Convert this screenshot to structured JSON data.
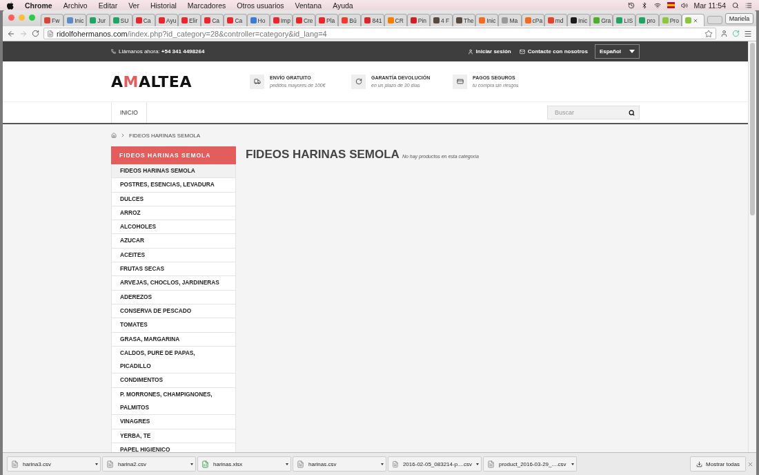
{
  "menubar": {
    "app": "Chrome",
    "items": [
      "Archivo",
      "Editar",
      "Ver",
      "Historial",
      "Marcadores",
      "Otros usuarios",
      "Ventana",
      "Ayuda"
    ],
    "clock": "Mar 11:54"
  },
  "tabs": [
    {
      "title": "Fw",
      "color": "#d44638",
      "selected": false
    },
    {
      "title": "Inic",
      "color": "#5b8bc9",
      "selected": false
    },
    {
      "title": "Jur",
      "color": "#1fa463",
      "selected": false
    },
    {
      "title": "SU",
      "color": "#1fa463",
      "selected": false
    },
    {
      "title": "Ca",
      "color": "#e8262b",
      "selected": false
    },
    {
      "title": "Ayu",
      "color": "#e8262b",
      "selected": false
    },
    {
      "title": "Elir",
      "color": "#e8262b",
      "selected": false
    },
    {
      "title": "Ca",
      "color": "#e8262b",
      "selected": false
    },
    {
      "title": "Ca",
      "color": "#e8262b",
      "selected": false
    },
    {
      "title": "Ho",
      "color": "#3a7bd5",
      "selected": false
    },
    {
      "title": "Imp",
      "color": "#e8262b",
      "selected": false
    },
    {
      "title": "Cre",
      "color": "#e8262b",
      "selected": false
    },
    {
      "title": "Pla",
      "color": "#e8262b",
      "selected": false
    },
    {
      "title": "Bú",
      "color": "#ee3b2b",
      "selected": false
    },
    {
      "title": "841",
      "color": "#d62a2a",
      "selected": false
    },
    {
      "title": "CR",
      "color": "#f57d00",
      "selected": false
    },
    {
      "title": "Pin",
      "color": "#cb2027",
      "selected": false
    },
    {
      "title": "4 F",
      "color": "#5a4a3e",
      "selected": false
    },
    {
      "title": "The",
      "color": "#5a4a3e",
      "selected": false
    },
    {
      "title": "Inic",
      "color": "#f26b21",
      "selected": false
    },
    {
      "title": "Ma",
      "color": "#9a9a9a",
      "selected": false
    },
    {
      "title": "cPa",
      "color": "#f26b21",
      "selected": false
    },
    {
      "title": "md",
      "color": "#e24329",
      "selected": false
    },
    {
      "title": "Inic",
      "color": "#1b1b1b",
      "selected": false
    },
    {
      "title": "Gra",
      "color": "#4caf2a",
      "selected": false
    },
    {
      "title": "LIS",
      "color": "#1fa463",
      "selected": false
    },
    {
      "title": "pro",
      "color": "#1fa463",
      "selected": false
    },
    {
      "title": "Pro",
      "color": "#8cc63f",
      "selected": false
    },
    {
      "color": "#8cc63f",
      "selected": true
    }
  ],
  "profile": "Mariela",
  "url": {
    "host": "ridolfohermanos.com",
    "path": "/index.php?id_category=28&controller=category&id_lang=4"
  },
  "topbar": {
    "phone_label": "Llámanos ahora:",
    "phone": "+54 341 4498264",
    "login": "Iniciar sesión",
    "contact": "Contacte con nosotros",
    "language": "Español"
  },
  "logo": [
    {
      "text": "A",
      "accent": false
    },
    {
      "text": "M",
      "accent": true
    },
    {
      "text": "ALTEA",
      "accent": false
    }
  ],
  "features": [
    {
      "kind": "truck",
      "title": "ENVÍO GRATUITO",
      "subtitle": "pedidos mayores de 100€"
    },
    {
      "kind": "refresh",
      "title": "GARANTÍA DEVOLUCIÓN",
      "subtitle": "en un plazo de 30 días"
    },
    {
      "kind": "card",
      "title": "PAGOS SEGUROS",
      "subtitle": "tu compra sin riesgos"
    }
  ],
  "nav": [
    "INICIO"
  ],
  "search": {
    "placeholder": "Buscar"
  },
  "breadcrumb": "FIDEOS HARINAS SEMOLA",
  "sidebar": {
    "title": "FIDEOS HARINAS SEMOLA",
    "items": [
      {
        "label": "FIDEOS HARINAS SEMOLA",
        "selected": true
      },
      {
        "label": "POSTRES, ESENCIAS, LEVADURA",
        "selected": false
      },
      {
        "label": "DULCES",
        "selected": false
      },
      {
        "label": "ARROZ",
        "selected": false
      },
      {
        "label": "ALCOHOLES",
        "selected": false
      },
      {
        "label": "AZUCAR",
        "selected": false
      },
      {
        "label": "ACEITES",
        "selected": false
      },
      {
        "label": "FRUTAS SECAS",
        "selected": false
      },
      {
        "label": "ARVEJAS, CHOCLOS, JARDINERAS",
        "selected": false
      },
      {
        "label": "ADEREZOS",
        "selected": false
      },
      {
        "label": "CONSERVA DE PESCADO",
        "selected": false
      },
      {
        "label": "TOMATES",
        "selected": false
      },
      {
        "label": "GRASA, MARGARINA",
        "selected": false
      },
      {
        "label": "CALDOS, PURE DE PAPAS, PICADILLO",
        "selected": false
      },
      {
        "label": "CONDIMENTOS",
        "selected": false
      },
      {
        "label": "P. MORRONES, CHAMPIGNONES, PALMITOS",
        "selected": false
      },
      {
        "label": "VINAGRES",
        "selected": false
      },
      {
        "label": "YERBA, TE",
        "selected": false
      },
      {
        "label": "PAPEL HIGIENICO",
        "selected": false
      }
    ]
  },
  "heading": "FIDEOS HARINAS SEMOLA",
  "note": "No hay productos en esta categoría",
  "downloads": [
    {
      "name": "harina3.csv",
      "kind": "csv"
    },
    {
      "name": "harina2.csv",
      "kind": "csv"
    },
    {
      "name": "harinas.xlsx",
      "kind": "xlsx"
    },
    {
      "name": "harinas.csv",
      "kind": "csv"
    },
    {
      "name": "2016-02-05_083214-p....csv",
      "kind": "csv"
    },
    {
      "name": "product_2016-03-29_....csv",
      "kind": "csv"
    }
  ],
  "show_all": "Mostrar todas"
}
